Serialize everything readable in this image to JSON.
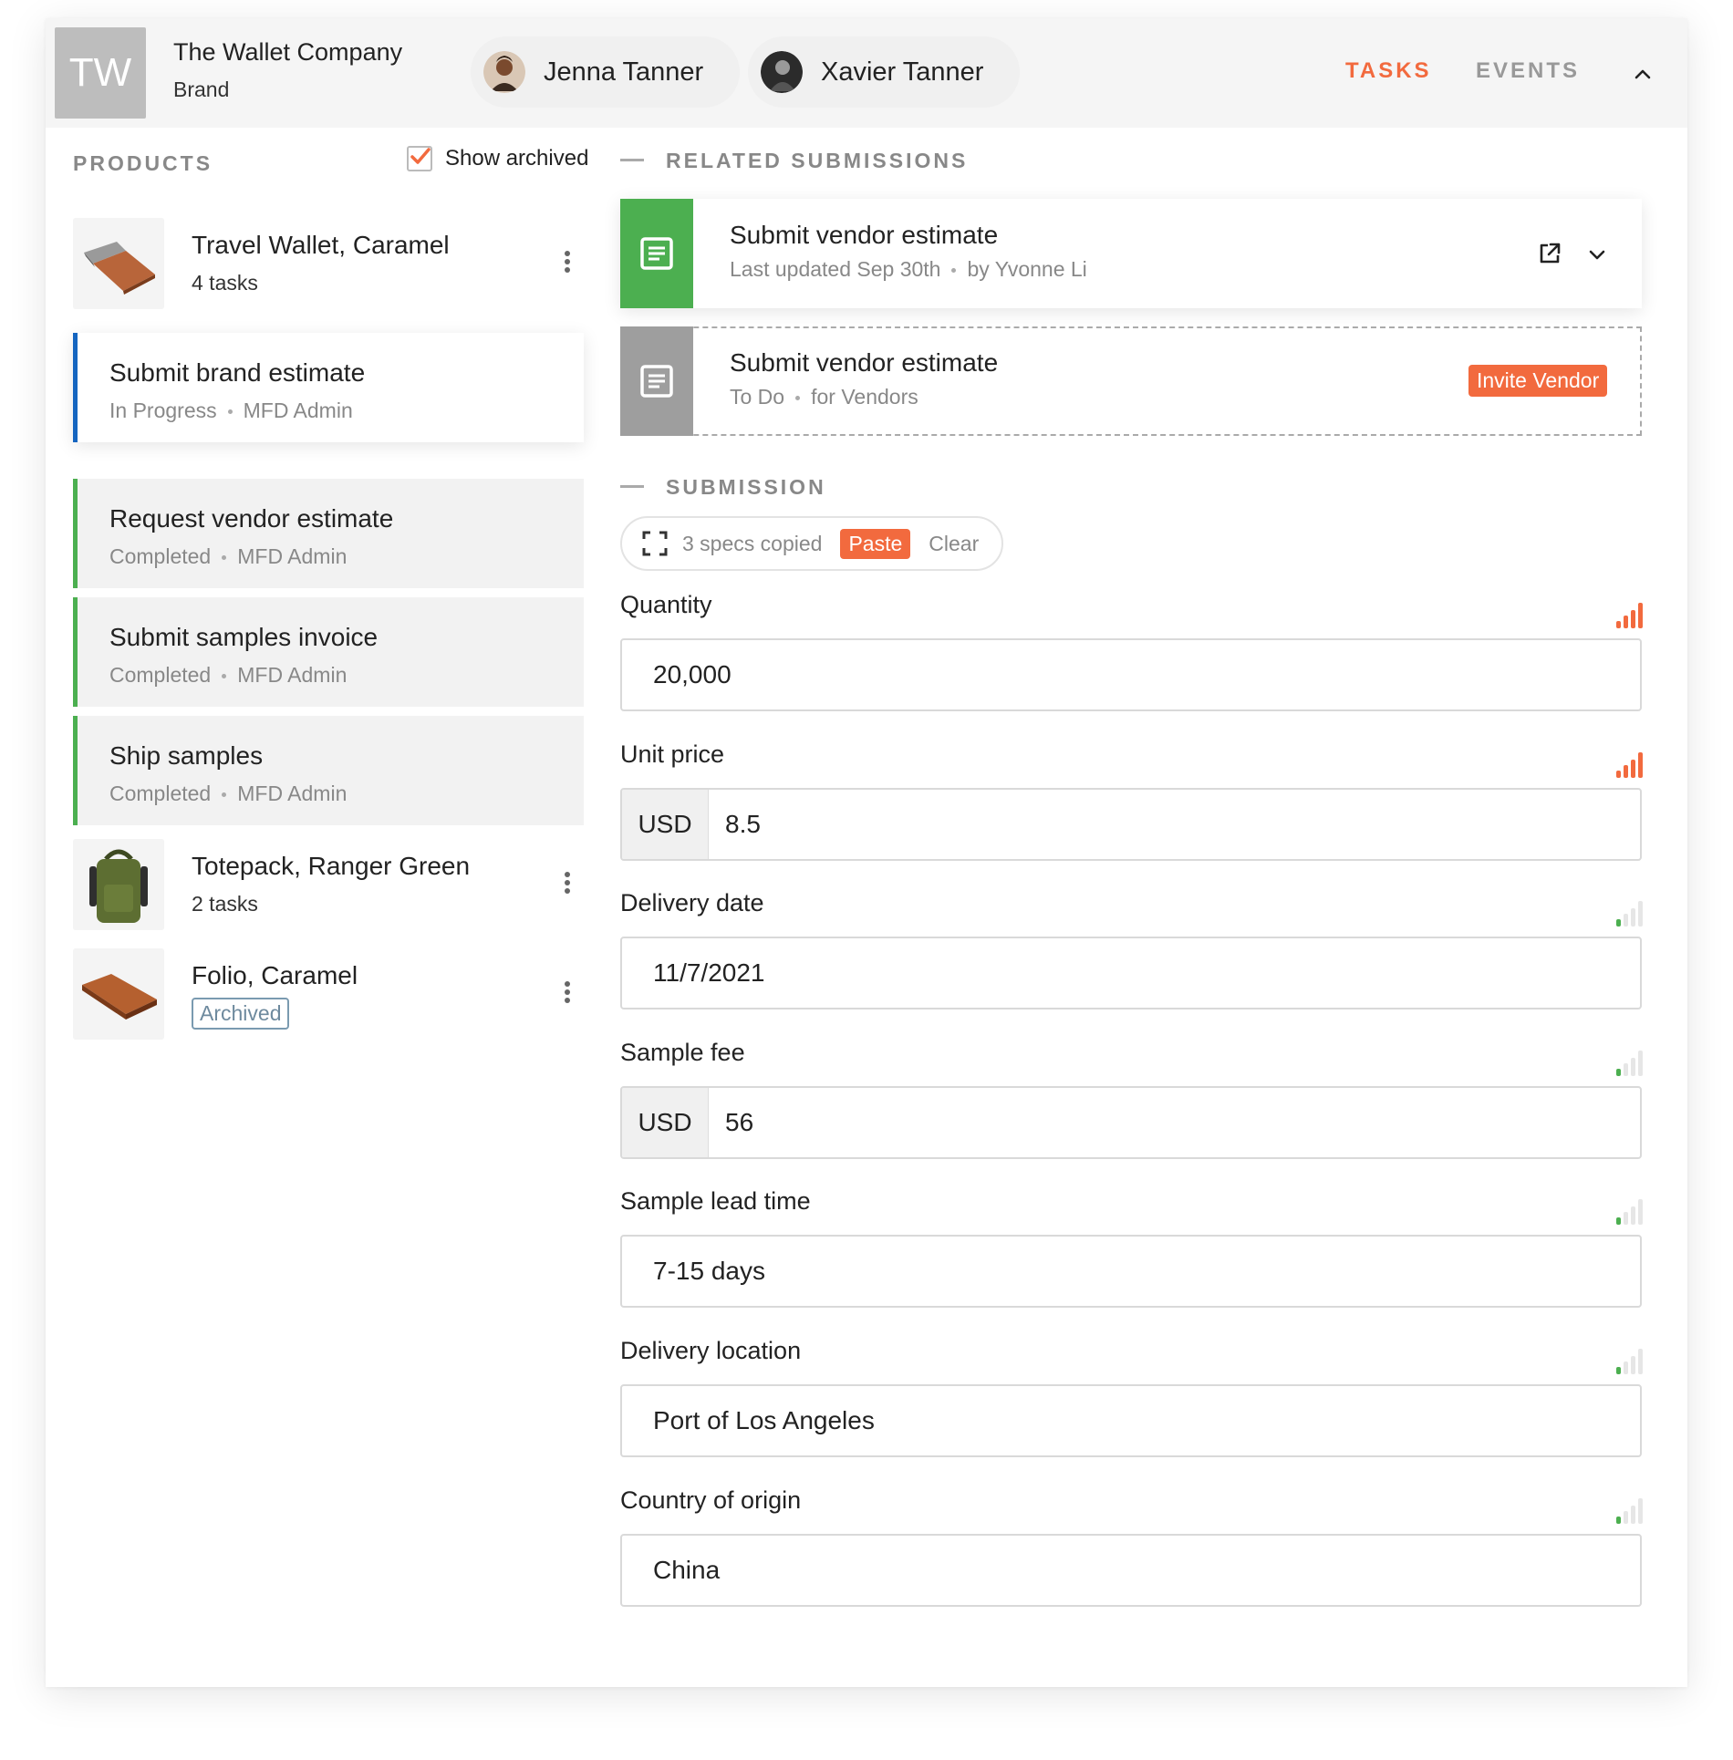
{
  "header": {
    "logo_initials": "TW",
    "company_name": "The Wallet Company",
    "company_role": "Brand",
    "people": [
      {
        "name": "Jenna Tanner",
        "avatar": "avatar-icon"
      },
      {
        "name": "Xavier Tanner",
        "avatar": "avatar-icon"
      }
    ],
    "tabs": [
      {
        "label": "TASKS",
        "active": true
      },
      {
        "label": "EVENTS",
        "active": false
      }
    ],
    "collapse_icon": "chevron-up-icon"
  },
  "products_panel": {
    "title": "PRODUCTS",
    "show_archived_label": "Show archived",
    "show_archived_checked": true,
    "products": [
      {
        "name": "Travel Wallet, Caramel",
        "tasks": "4 tasks"
      },
      {
        "name": "Totepack, Ranger Green",
        "tasks": "2 tasks"
      },
      {
        "name": "Folio, Caramel",
        "badge": "Archived"
      }
    ],
    "tasks": [
      {
        "title": "Submit brand estimate",
        "status": "In Progress",
        "owner": "MFD Admin",
        "selected": true
      },
      {
        "title": "Request vendor estimate",
        "status": "Completed",
        "owner": "MFD Admin"
      },
      {
        "title": "Submit samples invoice",
        "status": "Completed",
        "owner": "MFD Admin"
      },
      {
        "title": "Ship samples",
        "status": "Completed",
        "owner": "MFD Admin"
      }
    ]
  },
  "related": {
    "title": "RELATED SUBMISSIONS",
    "items": [
      {
        "title": "Submit vendor estimate",
        "status": "Last updated Sep 30th",
        "meta": "by Yvonne Li"
      },
      {
        "title": "Submit vendor estimate",
        "status": "To Do",
        "meta": "for Vendors",
        "action": "Invite Vendor"
      }
    ]
  },
  "submission": {
    "title": "SUBMISSION",
    "clipboard": {
      "text": "3 specs copied",
      "paste": "Paste",
      "clear": "Clear"
    },
    "fields": [
      {
        "label": "Quantity",
        "value": "20,000",
        "signal": 4
      },
      {
        "label": "Unit price",
        "currency": "USD",
        "value": "8.5",
        "signal": 4
      },
      {
        "label": "Delivery date",
        "value": "11/7/2021",
        "signal": 1
      },
      {
        "label": "Sample fee",
        "currency": "USD",
        "value": "56",
        "signal": 1
      },
      {
        "label": "Sample lead time",
        "value": "7-15 days",
        "signal": 1
      },
      {
        "label": "Delivery location",
        "value": "Port of Los Angeles",
        "signal": 1
      },
      {
        "label": "Country of origin",
        "value": "China",
        "signal": 1
      }
    ]
  },
  "colors": {
    "accent": "#f26a3e",
    "success": "#4caf50",
    "selected_bar": "#1565c0",
    "muted": "#9e9e9e"
  }
}
